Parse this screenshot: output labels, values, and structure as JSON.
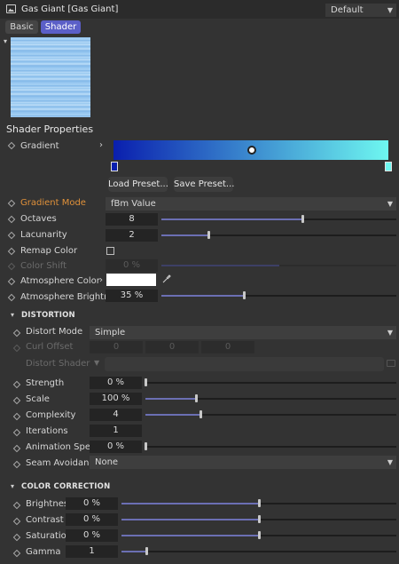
{
  "header": {
    "title": "Gas Giant [Gas Giant]",
    "preset": "Default"
  },
  "tabs": [
    {
      "label": "Basic"
    },
    {
      "label": "Shader"
    }
  ],
  "shader_properties": {
    "title": "Shader Properties",
    "gradient_label": "Gradient",
    "load_preset": "Load Preset...",
    "save_preset": "Save Preset...",
    "gradient_colors": {
      "start": "#0a1fae",
      "end": "#6ef7f0"
    },
    "gradient_mode": {
      "label": "Gradient Mode",
      "value": "fBm Value"
    },
    "octaves": {
      "label": "Octaves",
      "value": "8",
      "fraction": 0.6
    },
    "lacunarity": {
      "label": "Lacunarity",
      "value": "2",
      "fraction": 0.2
    },
    "remap_color": {
      "label": "Remap Color",
      "checked": false
    },
    "color_shift": {
      "label": "Color Shift",
      "value": "0 %",
      "fraction": 0.5
    },
    "atmosphere_color": {
      "label": "Atmosphere Color",
      "color": "#ffffff"
    },
    "atmosphere_brightness": {
      "label": "Atmosphere Brightness",
      "value": "35 %",
      "fraction": 0.35
    }
  },
  "distortion": {
    "title": "DISTORTION",
    "distort_mode": {
      "label": "Distort Mode",
      "value": "Simple"
    },
    "curl_offset": {
      "label": "Curl Offset",
      "x": "0",
      "y": "0",
      "z": "0"
    },
    "distort_shader": {
      "label": "Distort Shader"
    },
    "strength": {
      "label": "Strength",
      "value": "0 %",
      "fraction": 0.0
    },
    "scale": {
      "label": "Scale",
      "value": "100 %",
      "fraction": 0.2
    },
    "complexity": {
      "label": "Complexity",
      "value": "4",
      "fraction": 0.22
    },
    "iterations": {
      "label": "Iterations",
      "value": "1"
    },
    "animation_speed": {
      "label": "Animation Speed",
      "value": "0 %",
      "fraction": 0.0
    },
    "seam_avoidance": {
      "label": "Seam Avoidance",
      "value": "None"
    }
  },
  "color_correction": {
    "title": "COLOR CORRECTION",
    "brightness": {
      "label": "Brightness",
      "value": "0 %",
      "fraction": 0.5
    },
    "contrast": {
      "label": "Contrast",
      "value": "0 %",
      "fraction": 0.5
    },
    "saturation": {
      "label": "Saturation",
      "value": "0 %",
      "fraction": 0.5
    },
    "gamma": {
      "label": "Gamma",
      "value": "1",
      "fraction": 0.09
    }
  },
  "colors": {
    "accent": "#5b5fc7",
    "slider_fill": "#6b6fb3",
    "label_orange": "#e0913a"
  },
  "icons": [
    "image-icon",
    "chevron-down-icon",
    "chevron-right-icon",
    "diamond-icon",
    "eyedropper-icon",
    "folder-icon"
  ]
}
